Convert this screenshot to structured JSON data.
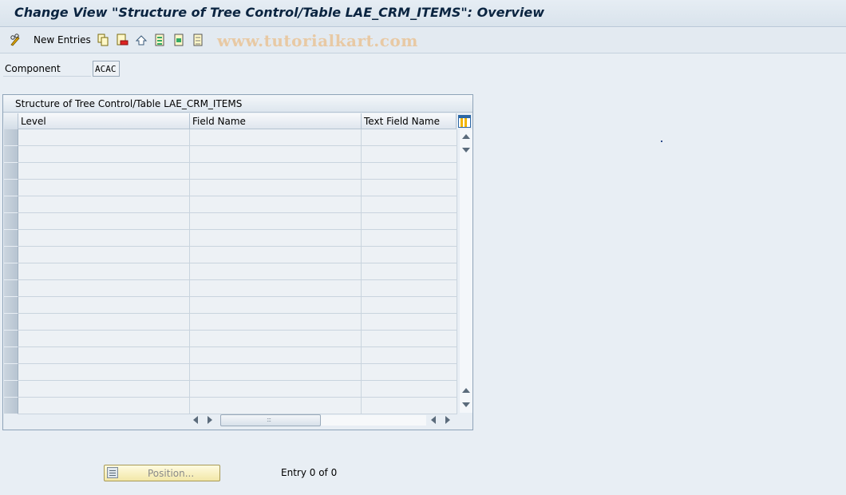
{
  "window": {
    "title": "Change View \"Structure of Tree Control/Table LAE_CRM_ITEMS\": Overview"
  },
  "toolbar": {
    "change_icon": "pencil-glasses-icon",
    "new_entries_label": "New Entries",
    "icons": [
      "copy-icon",
      "delete-icon",
      "undo-icon",
      "select-all-icon",
      "select-block-icon",
      "deselect-all-icon"
    ],
    "watermark": "www.tutorialkart.com"
  },
  "form": {
    "component_label": "Component",
    "component_value": "ACAC"
  },
  "table": {
    "title": "Structure of Tree Control/Table LAE_CRM_ITEMS",
    "columns": [
      "Level",
      "Field Name",
      "Text Field Name"
    ],
    "row_count_visible": 17,
    "rows": []
  },
  "footer": {
    "position_label": "Position...",
    "entry_text": "Entry 0 of 0"
  },
  "colors": {
    "background": "#e8eef4",
    "title_text": "#0a2440",
    "position_button": "#f2e7a8"
  }
}
